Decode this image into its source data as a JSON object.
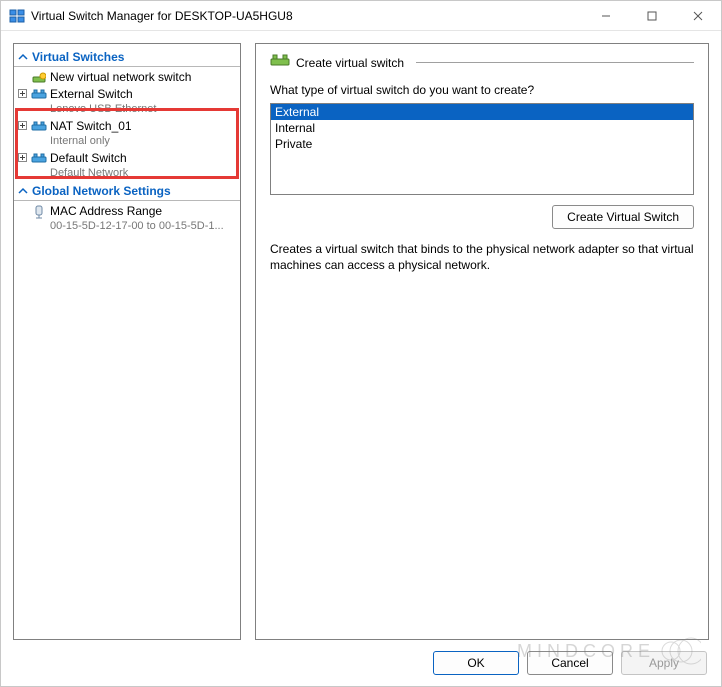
{
  "window": {
    "title": "Virtual Switch Manager for DESKTOP-UA5HGU8"
  },
  "sidebar": {
    "section_switches": "Virtual Switches",
    "section_global": "Global Network Settings",
    "new_switch": "New virtual network switch",
    "items": [
      {
        "name": "External Switch",
        "sub": "Lenovo USB Ethernet"
      },
      {
        "name": "NAT Switch_01",
        "sub": "Internal only"
      },
      {
        "name": "Default Switch",
        "sub": "Default Network"
      }
    ],
    "mac": {
      "title": "MAC Address Range",
      "sub": "00-15-5D-12-17-00 to 00-15-5D-1..."
    }
  },
  "pane": {
    "header": "Create virtual switch",
    "prompt": "What type of virtual switch do you want to create?",
    "options": [
      "External",
      "Internal",
      "Private"
    ],
    "create_btn": "Create Virtual Switch",
    "description": "Creates a virtual switch that binds to the physical network adapter so that virtual machines can access a physical network."
  },
  "footer": {
    "ok": "OK",
    "cancel": "Cancel",
    "apply": "Apply"
  },
  "watermark": "MINDCORE"
}
